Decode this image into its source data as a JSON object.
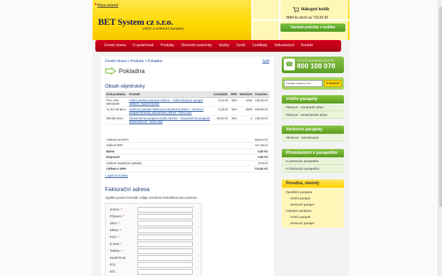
{
  "header": {
    "map_link": "Mapa stránek",
    "logo": "BET System cz s.r.o.",
    "logo_sub": "vnitřní a venkovní parapety",
    "cart_title": "Nákupní košík",
    "cart_summary": "3584 ks zboží za 710,00 Kč",
    "cart_button": "Upravit položky v košíku"
  },
  "nav": {
    "items": [
      "Úvodní strana",
      "O společnosti",
      "Produkty",
      "Obchodní podmínky",
      "Služby",
      "Ceník",
      "Certifikáty",
      "Velkoobchod",
      "Kontakt"
    ]
  },
  "main": {
    "breadcrumb": "Úvodní strana » Produkty » Pokladna",
    "print_link": "Zpět",
    "page_title": "Pokladna",
    "order_heading": "Obsah objednávky",
    "columns": [
      "Kód produktu",
      "Produkt",
      "Cena/jedn.",
      "DPH",
      "Množství",
      "Cena/mn."
    ],
    "rows": [
      {
        "code": "PVC-100-MRAMOR",
        "product": "Vnitřní plastový parapet 100mm - Vnitřní plastový parapet 100mm - barva mramor",
        "price": "0,12 Kč",
        "vat": "19%",
        "qty": "1000",
        "total": "120,00 Kč"
      },
      {
        "code": "AL-EX-50-BILA",
        "product": "Venkovní parapet hliníkový extrudovaný 50mm - Venkovní parapet hliníkový extrudovaný 50mm - barva bílá",
        "price": "0,18 Kč",
        "vat": "19%",
        "qty": "2500",
        "total": "450,00 Kč"
      },
      {
        "code": "OB-601-BILA",
        "product": "Obousměrná parapetní krytka 601mm - Obousměrná parapetní krytka 601mm - barva bílá",
        "price": "35,00 Kč",
        "vat": "19%",
        "qty": "4",
        "total": "140,00 Kč"
      }
    ],
    "totals": [
      {
        "label": "Celkem bez DPH",
        "value": "592,54 Kč",
        "bold": false
      },
      {
        "label": "Celkem DPH",
        "value": "117,36 Kč",
        "bold": false
      },
      {
        "label": "Balné",
        "value": "0,00 Kč",
        "bold": true
      },
      {
        "label": "Dopravné",
        "value": "0,00 Kč",
        "bold": true
      },
      {
        "label": "Celkem recyklační poplatky",
        "value": "0,00 Kč",
        "bold": false
      },
      {
        "label": "Celkem s DPH",
        "value": "710,00 Kč",
        "bold": true
      }
    ],
    "back_link": "« Zpět do košíku",
    "billing_heading": "Fakturační adresa",
    "form_hint": "Vyplňte prosím formulář. Údaje označené hvězdičkou jsou povinné.",
    "form_fields": [
      {
        "label": "Jméno:",
        "required": true
      },
      {
        "label": "Příjmení:",
        "required": true
      },
      {
        "label": "Ulice:",
        "required": true
      },
      {
        "label": "Město:",
        "required": true
      },
      {
        "label": "PSČ:",
        "required": true
      },
      {
        "label": "E-mail:",
        "required": true
      },
      {
        "label": "Telefon:",
        "required": true
      },
      {
        "label": "Společnost:",
        "required": false
      },
      {
        "label": "IČO:",
        "required": false
      },
      {
        "label": "DIČ:",
        "required": false
      }
    ]
  },
  "sidebar": {
    "phone_label": "VOLEJTE ZDARMA PO CELÉ ČR",
    "phone_number": "800 100 078",
    "search_placeholder": "Zadejte hledaný text",
    "search_button": "HLEDAT",
    "box1": {
      "title": "Vnitřní parapety",
      "items": [
        "Plastové - standardní dekor",
        "Plastové - nestandardní dekor"
      ]
    },
    "box2": {
      "title": "Venkovní parapety",
      "items": [
        "Hliníkové - extrudované"
      ]
    },
    "box3": {
      "title": "Příslušenství k parapetům",
      "items": [
        "K plastovým parapetům",
        "K hliníkovým parapetům"
      ]
    },
    "box4": {
      "title": "Poradna, návody",
      "items": [
        {
          "label": "Zaměření parapetu",
          "indent": false
        },
        {
          "label": "Vnitřní parapet",
          "indent": true
        },
        {
          "label": "Venkovní parapet",
          "indent": true
        },
        {
          "label": "Instalace parapetu",
          "indent": false
        },
        {
          "label": "Vnitřní parapet",
          "indent": true
        },
        {
          "label": "Venkovní parapet",
          "indent": true
        }
      ]
    }
  }
}
